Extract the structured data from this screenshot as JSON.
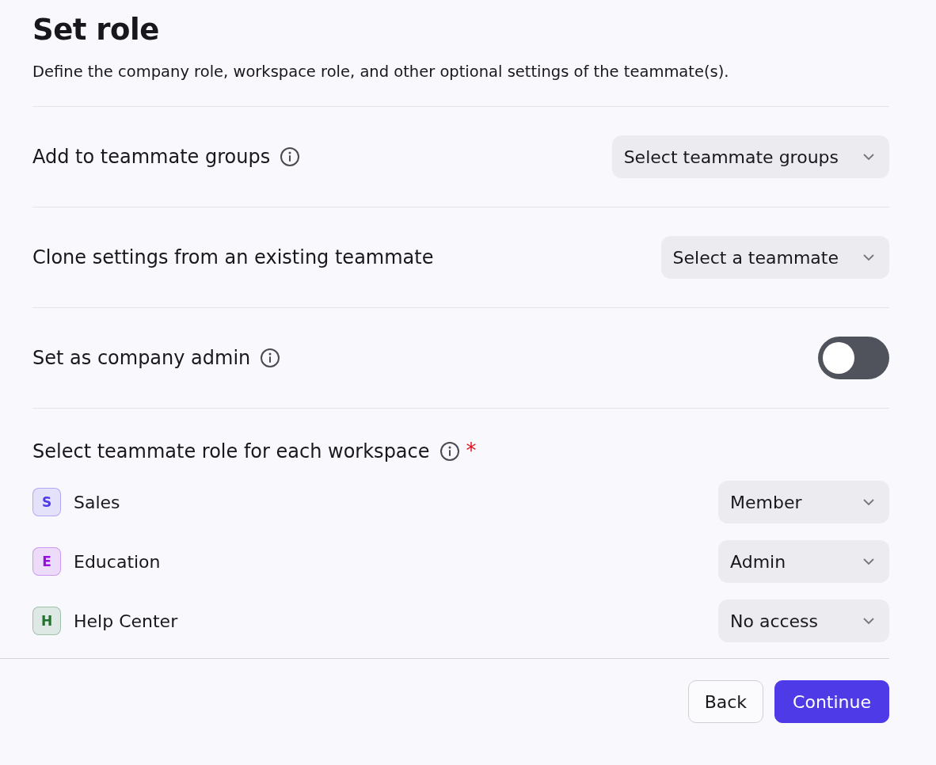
{
  "title": "Set role",
  "description": "Define the company role, workspace role, and other optional settings of the teammate(s).",
  "settings": [
    {
      "kind": "select",
      "label": "Add to teammate groups",
      "info": true,
      "placeholder": "Select teammate groups"
    },
    {
      "kind": "select",
      "label": "Clone settings from an existing teammate",
      "info": false,
      "placeholder": "Select a teammate"
    },
    {
      "kind": "toggle",
      "label": "Set as company admin",
      "info": true,
      "on": false
    }
  ],
  "workspaces_section": {
    "label": "Select teammate role for each workspace",
    "info": true,
    "required": true,
    "required_mark": "*"
  },
  "workspaces": [
    {
      "initial": "S",
      "name": "Sales",
      "color": "#4f3ae8",
      "role": "Member"
    },
    {
      "initial": "E",
      "name": "Education",
      "color": "#9510e0",
      "role": "Admin"
    },
    {
      "initial": "H",
      "name": "Help Center",
      "color": "#23712f",
      "role": "No access"
    }
  ],
  "buttons": [
    {
      "label": "Back",
      "kind": "secondary"
    },
    {
      "label": "Continue",
      "kind": "primary"
    }
  ]
}
